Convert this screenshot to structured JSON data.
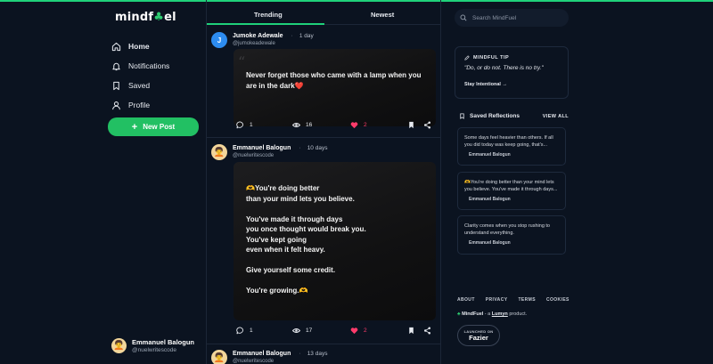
{
  "app": {
    "logo_text_a": "mindf",
    "logo_text_b": "el",
    "accent": "#1fd17a"
  },
  "sidebar": {
    "items": [
      {
        "label": "Home",
        "icon": "home-icon"
      },
      {
        "label": "Notifications",
        "icon": "bell-icon"
      },
      {
        "label": "Saved",
        "icon": "bookmark-icon"
      },
      {
        "label": "Profile",
        "icon": "user-icon"
      }
    ],
    "new_post_label": "New Post"
  },
  "current_user": {
    "name": "Emmanuel Balogun",
    "handle": "@nuelwritescode"
  },
  "tabs": [
    {
      "label": "Trending"
    },
    {
      "label": "Newest"
    }
  ],
  "posts": [
    {
      "author": "Jumoke Adewale",
      "handle": "@jumokeadewale",
      "time": "1 day",
      "avatar_letter": "J",
      "text": "Never forget those who came with a lamp when you\nare in the dark❤️",
      "comments": "1",
      "views": "16",
      "likes": "2"
    },
    {
      "author": "Emmanuel Balogun",
      "handle": "@nuelwritescode",
      "time": "10 days",
      "text": "🫶You're doing better\nthan your mind lets you believe.\n\nYou've made it through days\nyou once thought would break you.\nYou've kept going\neven when it felt heavy.\n\nGive yourself some credit.\n\nYou're growing.🫶",
      "comments": "1",
      "views": "17",
      "likes": "2"
    },
    {
      "author": "Emmanuel Balogun",
      "handle": "@nuelwritescode",
      "time": "13 days"
    }
  ],
  "search": {
    "placeholder": "Search MindFuel"
  },
  "tip": {
    "label": "MINDFUL TIP",
    "quote": "\"Do, or do not. There is no try.\"",
    "link": "Stay Intentional →"
  },
  "saved": {
    "title": "Saved Reflections",
    "view_all": "VIEW ALL",
    "items": [
      {
        "text": "Some days feel heavier than others. If all you did today was keep going, that's...",
        "author": "Emmanuel Balogun"
      },
      {
        "text": "🫶You're doing better than your mind lets you believe. You've made it through days...",
        "author": "Emmanuel Balogun"
      },
      {
        "text": "Clarity comes when you stop rushing to understand everything.",
        "author": "Emmanuel Balogun"
      }
    ]
  },
  "footer": {
    "links": [
      "ABOUT",
      "PRIVACY",
      "TERMS",
      "COOKIES"
    ],
    "credit_brand": "MindFuel",
    "credit_mid": " - a ",
    "credit_company": "Lumyn",
    "credit_end": " product.",
    "badge_top": "LAUNCHED ON",
    "badge_name": "Fazier"
  }
}
